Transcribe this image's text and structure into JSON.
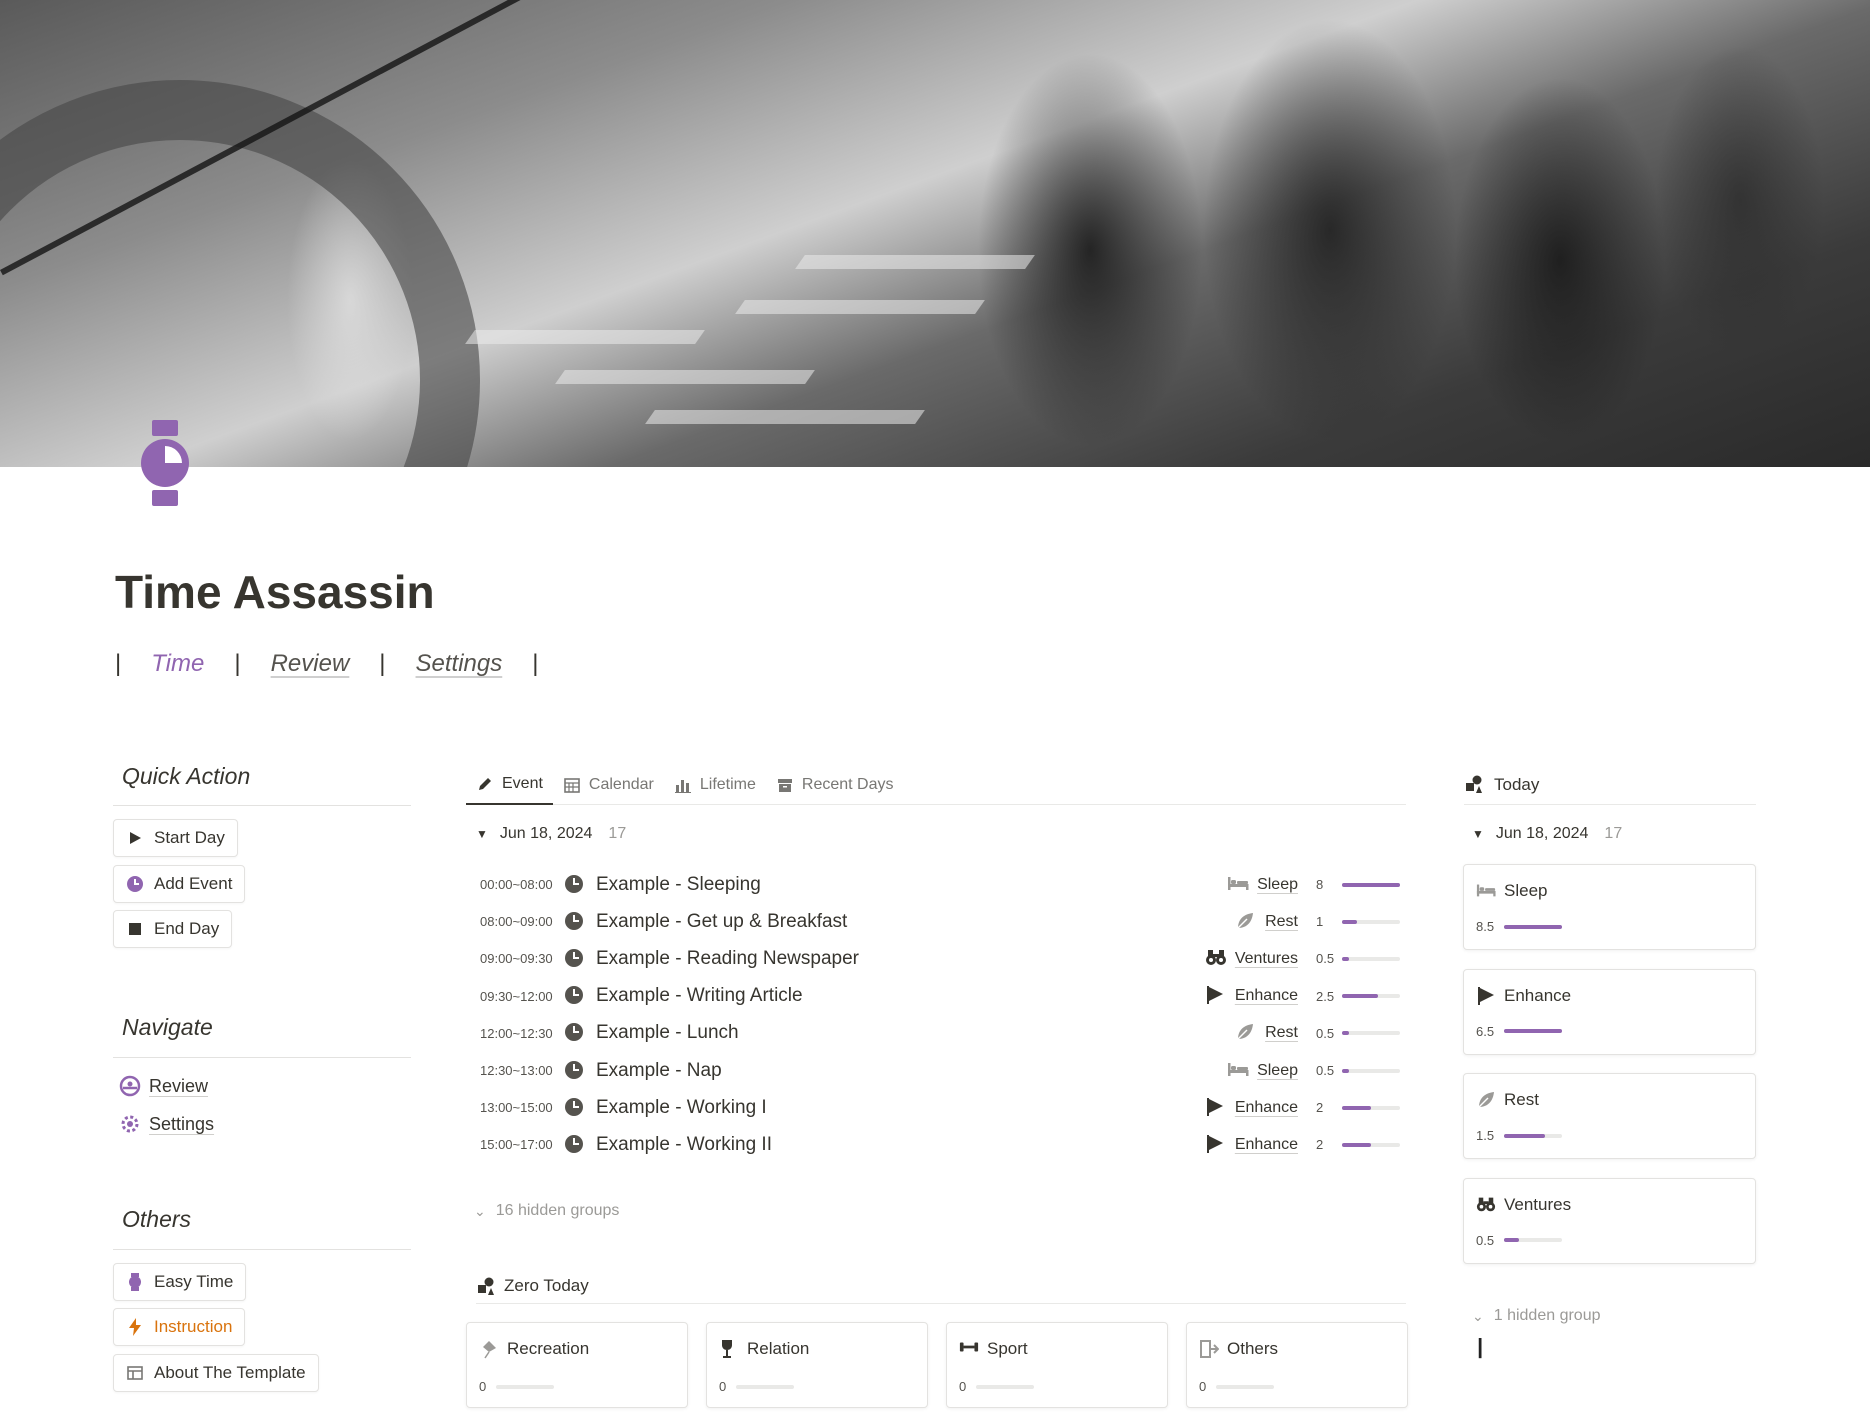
{
  "page": {
    "title": "Time Assassin",
    "accent_color": "#9065b0",
    "icon": "watch-icon"
  },
  "top_tabs": [
    {
      "label": "Time",
      "active": true
    },
    {
      "label": "Review",
      "active": false
    },
    {
      "label": "Settings",
      "active": false
    }
  ],
  "top_tabs_separator": "|",
  "quick_action": {
    "title": "Quick Action",
    "buttons": [
      {
        "label": "Start Day",
        "icon": "play-icon"
      },
      {
        "label": "Add Event",
        "icon": "clock-icon"
      },
      {
        "label": "End Day",
        "icon": "stop-icon"
      }
    ]
  },
  "navigate": {
    "title": "Navigate",
    "links": [
      {
        "label": "Review",
        "icon": "gauge-icon"
      },
      {
        "label": "Settings",
        "icon": "gear-icon"
      }
    ]
  },
  "others": {
    "title": "Others",
    "buttons": [
      {
        "label": "Easy Time",
        "icon": "watch-icon"
      },
      {
        "label": "Instruction",
        "icon": "lightning-icon"
      },
      {
        "label": "About The Template",
        "icon": "table-icon"
      }
    ]
  },
  "views": {
    "tabs": [
      {
        "label": "Event",
        "icon": "pencil-icon",
        "active": true
      },
      {
        "label": "Calendar",
        "icon": "calendar-icon",
        "active": false
      },
      {
        "label": "Lifetime",
        "icon": "bar-chart-icon",
        "active": false
      },
      {
        "label": "Recent Days",
        "icon": "archive-icon",
        "active": false
      }
    ]
  },
  "event_group": {
    "date": "Jun 18, 2024",
    "count": "17",
    "rows": [
      {
        "time": "00:00~08:00",
        "title": "Example - Sleeping",
        "category": "Sleep",
        "cat_icon": "bed-icon",
        "value": "8",
        "fraction": 1.0
      },
      {
        "time": "08:00~09:00",
        "title": "Example - Get up & Breakfast",
        "category": "Rest",
        "cat_icon": "leaf-icon",
        "value": "1",
        "fraction": 0.25
      },
      {
        "time": "09:00~09:30",
        "title": "Example - Reading Newspaper",
        "category": "Ventures",
        "cat_icon": "binoculars-icon",
        "value": "0.5",
        "fraction": 0.12
      },
      {
        "time": "09:30~12:00",
        "title": "Example - Writing Article",
        "category": "Enhance",
        "cat_icon": "flag-icon",
        "value": "2.5",
        "fraction": 0.62
      },
      {
        "time": "12:00~12:30",
        "title": "Example - Lunch",
        "category": "Rest",
        "cat_icon": "leaf-icon",
        "value": "0.5",
        "fraction": 0.12
      },
      {
        "time": "12:30~13:00",
        "title": "Example - Nap",
        "category": "Sleep",
        "cat_icon": "bed-icon",
        "value": "0.5",
        "fraction": 0.12
      },
      {
        "time": "13:00~15:00",
        "title": "Example - Working I",
        "category": "Enhance",
        "cat_icon": "flag-icon",
        "value": "2",
        "fraction": 0.5
      },
      {
        "time": "15:00~17:00",
        "title": "Example - Working II",
        "category": "Enhance",
        "cat_icon": "flag-icon",
        "value": "2",
        "fraction": 0.5
      }
    ],
    "hidden_label": "16 hidden groups"
  },
  "zero_today": {
    "title": "Zero Today",
    "icon": "shapes-icon",
    "cards": [
      {
        "label": "Recreation",
        "icon": "kite-icon",
        "value": "0",
        "fraction": 0
      },
      {
        "label": "Relation",
        "icon": "wine-icon",
        "value": "0",
        "fraction": 0
      },
      {
        "label": "Sport",
        "icon": "dumbbell-icon",
        "value": "0",
        "fraction": 0
      },
      {
        "label": "Others",
        "icon": "exit-icon",
        "value": "0",
        "fraction": 0
      }
    ]
  },
  "today": {
    "title": "Today",
    "icon": "shapes-icon",
    "date": "Jun 18, 2024",
    "count": "17",
    "cards": [
      {
        "label": "Sleep",
        "icon": "bed-icon",
        "value": "8.5",
        "fraction": 1.0
      },
      {
        "label": "Enhance",
        "icon": "flag-icon",
        "value": "6.5",
        "fraction": 1.0
      },
      {
        "label": "Rest",
        "icon": "leaf-icon",
        "value": "1.5",
        "fraction": 0.7
      },
      {
        "label": "Ventures",
        "icon": "binoculars-icon",
        "value": "0.5",
        "fraction": 0.25
      }
    ],
    "hidden_label": "1 hidden group"
  }
}
